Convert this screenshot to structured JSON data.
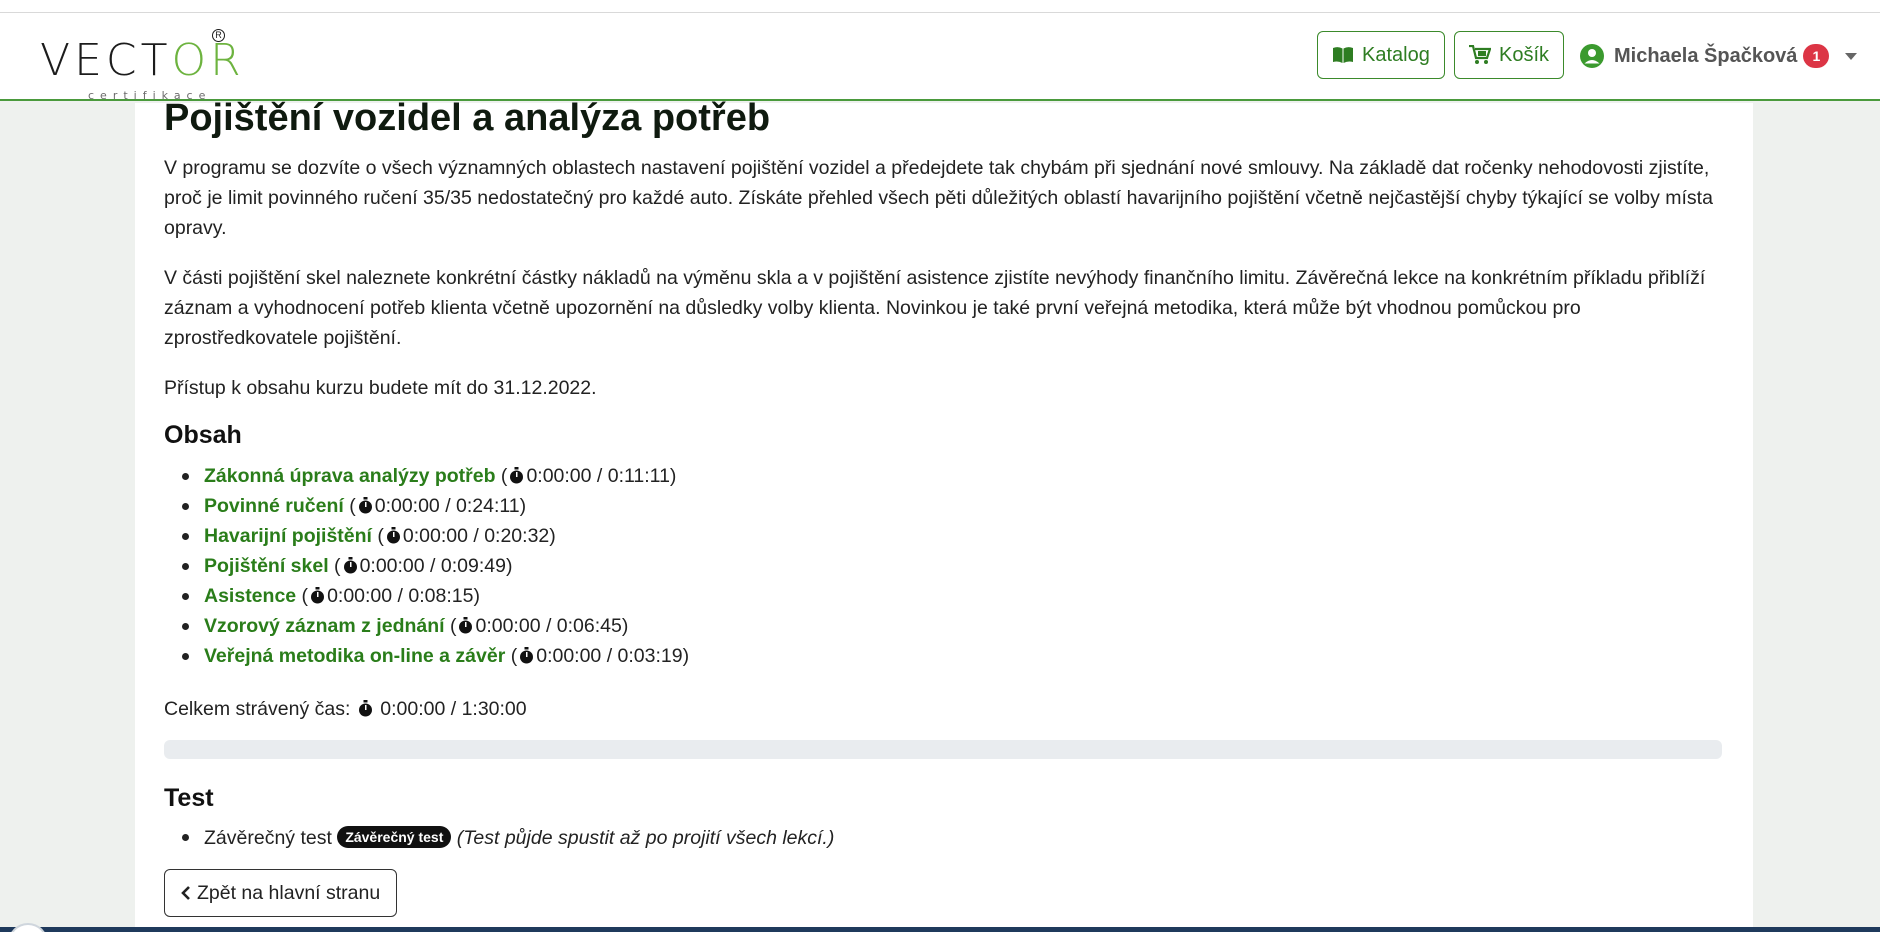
{
  "header": {
    "logo_text_before": "VEC",
    "logo_text_o": "T",
    "logo_text_after": "OR",
    "logo_sub": "certifikace",
    "katalog_label": "Katalog",
    "kosik_label": "Košík",
    "user_name": "Michaela Špačková",
    "notification_count": "1"
  },
  "course": {
    "title": "Pojištění vozidel a analýza potřeb",
    "paragraph1": "V programu se dozvíte o všech významných oblastech nastavení pojištění vozidel a předejdete tak chybám při sjednání nové smlouvy. Na základě dat ročenky nehodovosti zjistíte, proč je limit povinného ručení 35/35 nedostatečný pro každé auto. Získáte přehled všech pěti důležitých oblastí havarijního pojištění včetně nejčastější chyby týkající se volby místa opravy.",
    "paragraph2": "V části pojištění skel naleznete konkrétní částky nákladů na výměnu skla a v pojištění asistence zjistíte nevýhody finančního limitu. Závěrečná lekce na konkrétním příkladu přiblíží záznam a vyhodnocení potřeb klienta včetně upozornění na důsledky volby klienta. Novinkou je také první veřejná metodika, která může být vhodnou pomůckou pro zprostředkovatele pojištění.",
    "access": "Přístup k obsahu kurzu budete mít do 31.12.2022."
  },
  "contents": {
    "heading": "Obsah",
    "lessons": [
      {
        "title": "Zákonná úprava analýzy potřeb",
        "time": "0:00:00 / 0:11:11"
      },
      {
        "title": "Povinné ručení",
        "time": "0:00:00 / 0:24:11"
      },
      {
        "title": "Havarijní pojištění",
        "time": "0:00:00 / 0:20:32"
      },
      {
        "title": "Pojištění skel",
        "time": "0:00:00 / 0:09:49"
      },
      {
        "title": "Asistence",
        "time": "0:00:00 / 0:08:15"
      },
      {
        "title": "Vzorový záznam z jednání",
        "time": "0:00:00 / 0:06:45"
      },
      {
        "title": "Veřejná metodika on-line a závěr",
        "time": "0:00:00 / 0:03:19"
      }
    ],
    "total_label": "Celkem strávený čas:",
    "total_time": "0:00:00 / 1:30:00",
    "progress": 0
  },
  "test": {
    "heading": "Test",
    "item_label": "Závěrečný test",
    "badge": "Závěrečný test",
    "note": "(Test půjde spustit až po projití všech lekcí.)"
  },
  "back_button": "Zpět na hlavní stranu"
}
